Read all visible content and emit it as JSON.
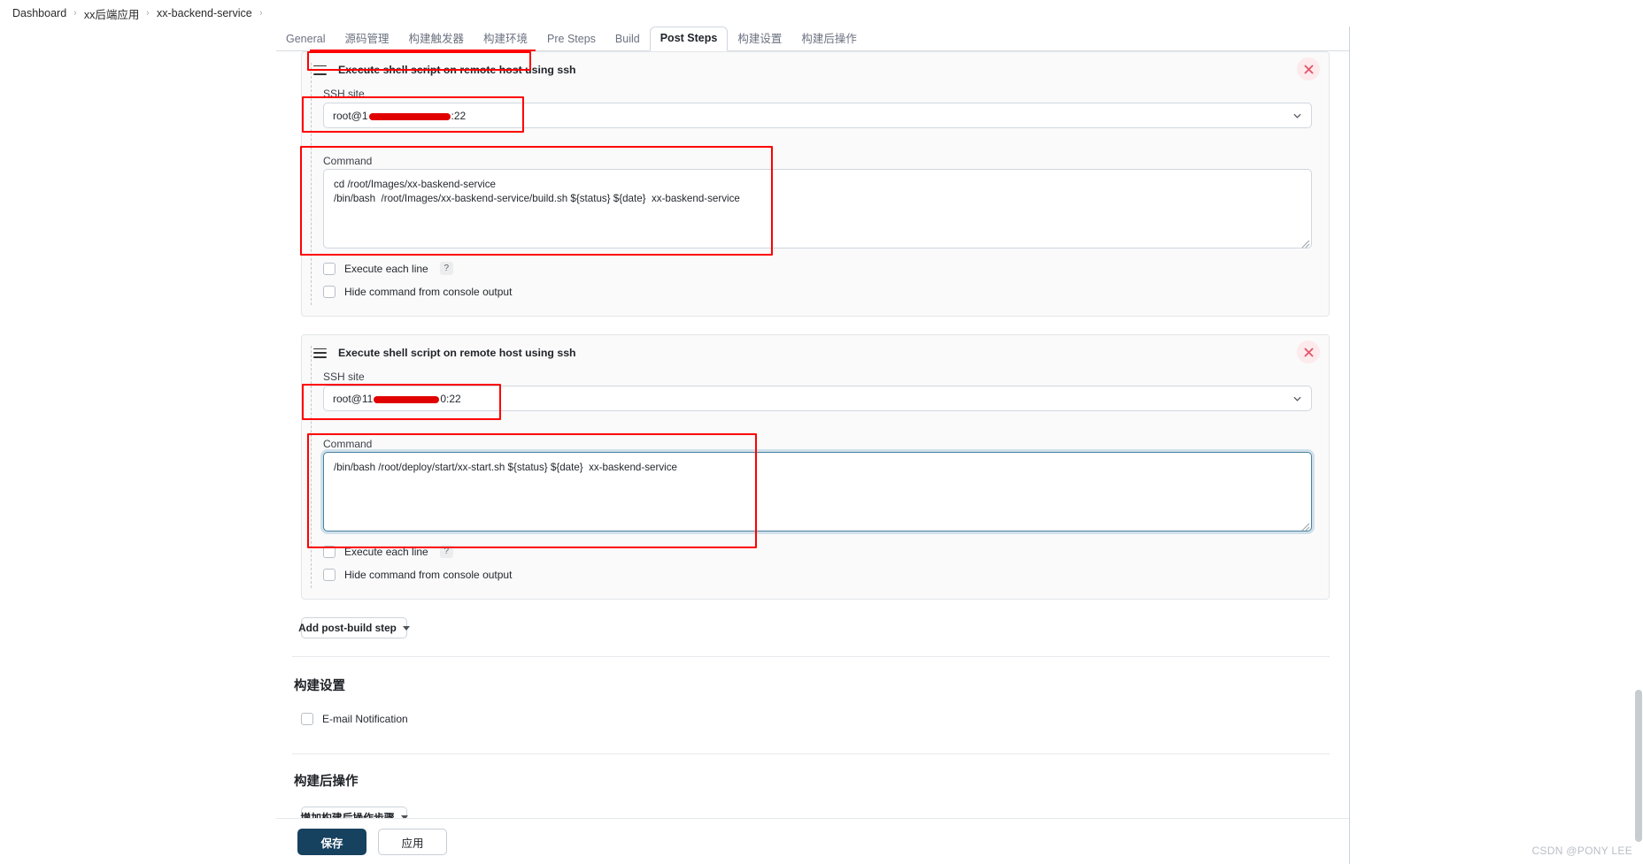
{
  "breadcrumb": {
    "items": [
      "Dashboard",
      "xx后端应用",
      "xx-backend-service"
    ],
    "separator": "›"
  },
  "tabs": [
    {
      "label": "General",
      "active": false
    },
    {
      "label": "源码管理",
      "active": false
    },
    {
      "label": "构建触发器",
      "active": false
    },
    {
      "label": "构建环境",
      "active": false
    },
    {
      "label": "Pre Steps",
      "active": false
    },
    {
      "label": "Build",
      "active": false
    },
    {
      "label": "Post Steps",
      "active": true
    },
    {
      "label": "构建设置",
      "active": false
    },
    {
      "label": "构建后操作",
      "active": false
    }
  ],
  "steps": [
    {
      "title": "Execute shell script on remote host using ssh",
      "ssh_site_label": "SSH site",
      "ssh_site_value_prefix": "root@1",
      "ssh_site_value_suffix": ":22",
      "command_label": "Command",
      "command_value": "cd /root/Images/xx-baskend-service\n/bin/bash  /root/Images/xx-baskend-service/build.sh ${status} ${date}  xx-baskend-service",
      "execute_each_line_label": "Execute each line",
      "help_glyph": "?",
      "hide_command_label": "Hide command from console output",
      "close_glyph": "×",
      "command_focused": false
    },
    {
      "title": "Execute shell script on remote host using ssh",
      "ssh_site_label": "SSH site",
      "ssh_site_value_prefix": "root@11",
      "ssh_site_value_suffix": "0:22",
      "command_label": "Command",
      "command_value": "/bin/bash /root/deploy/start/xx-start.sh ${status} ${date}  xx-baskend-service",
      "execute_each_line_label": "Execute each line",
      "help_glyph": "?",
      "hide_command_label": "Hide command from console output",
      "close_glyph": "×",
      "command_focused": true
    }
  ],
  "add_post_build_step_label": "Add post-build step",
  "build_settings": {
    "title": "构建设置",
    "email_notification_label": "E-mail Notification"
  },
  "post_build_actions": {
    "title": "构建后操作",
    "add_button_label": "增加构建后操作步骤"
  },
  "footer": {
    "save_label": "保存",
    "apply_label": "应用"
  },
  "watermark": "CSDN @PONY LEE",
  "colors": {
    "annotation_red": "#ff0000",
    "primary_button": "#16415f",
    "focus_border": "#4a7f9e",
    "close_badge_bg": "#fdeaec",
    "close_glyph": "#e2566a",
    "redaction": "#e00000"
  }
}
